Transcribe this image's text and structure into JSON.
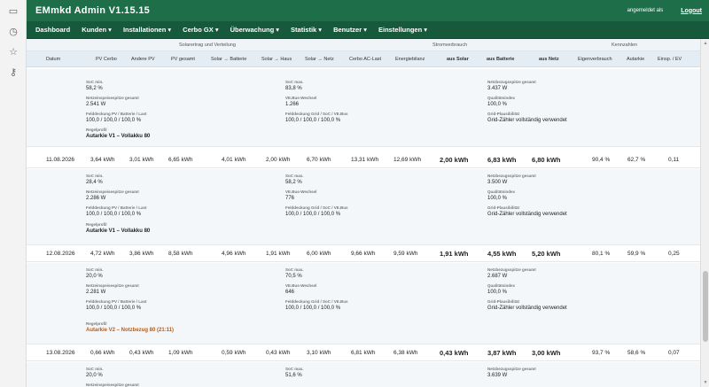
{
  "browser_rail": {
    "icons": [
      "folder-icon",
      "clock-icon",
      "star-icon",
      "key-icon"
    ]
  },
  "header": {
    "title": "EMmkd Admin V1.15.15",
    "user": "angemeldet als",
    "logout": "Logout"
  },
  "nav": {
    "items": [
      "Dashboard",
      "Kunden ▾",
      "Installationen ▾",
      "Cerbo GX ▾",
      "Überwachung ▾",
      "Statistik ▾",
      "Benutzer ▾",
      "Einstellungen ▾"
    ]
  },
  "table": {
    "groups": [
      "Solarertrag und Verteilung",
      "Stromverbrauch",
      "Kennzahlen"
    ],
    "columns": [
      "Datum",
      "PV Cerbo",
      "Andere PV",
      "PV gesamt",
      "Solar → Batterie",
      "Solar → Haus",
      "Solar → Netz",
      "Cerbo AC-Last",
      "Energiebilanz",
      "aus Solar",
      "aus Batterie",
      "aus Netz",
      "Eigenverbrauch",
      "Autarkie",
      "Einsp. / EV"
    ]
  },
  "labels": {
    "soc_min": "SoC min.",
    "soc_max": "SoC max.",
    "netzbezug_max": "Netzbezugsspitze gesamt",
    "netzeinspeisung_max": "Netzeinspeisespitze gesamt",
    "ve_bus_wechsel": "VE.Bus-Wechsel",
    "qualitaetsindex": "Qualitätsindex",
    "deckung_pv": "Felddeckung PV / Batterie / Last",
    "deckung_grid": "Felddeckung Grid / SoC / VE.Bus",
    "grid_plausi": "Grid-Plausibilität",
    "regelprofil": "Regelprofil"
  },
  "details": [
    {
      "soc_min": "58,2 %",
      "soc_max": "83,8 %",
      "netzbezug_max": "3.437 W",
      "netzeinspeisung_max": "2.541 W",
      "ve_bus_wechsel": "1.266",
      "qualitaetsindex": "100,0 %",
      "deckung_pv": "100,0 / 100,0 / 100,0 %",
      "deckung_grid": "100,0 / 100,0 / 100,0 %",
      "grid_plausi": "Grid-Zähler vollständig verwendet",
      "regelprofil": "Autarkie V1 – Vollakku 80"
    },
    {
      "soc_min": "28,4 %",
      "soc_max": "58,2 %",
      "netzbezug_max": "3.500 W",
      "netzeinspeisung_max": "2.286 W",
      "ve_bus_wechsel": "776",
      "qualitaetsindex": "100,0 %",
      "deckung_pv": "100,0 / 100,0 / 100,0 %",
      "deckung_grid": "100,0 / 100,0 / 100,0 %",
      "grid_plausi": "Grid-Zähler vollständig verwendet",
      "regelprofil": "Autarkie V1 – Vollakku 80"
    },
    {
      "soc_min": "20,0 %",
      "soc_max": "70,5 %",
      "netzbezug_max": "2.687 W",
      "netzeinspeisung_max": "2.281 W",
      "ve_bus_wechsel": "646",
      "qualitaetsindex": "100,0 %",
      "deckung_pv": "100,0 / 100,0 / 100,0 %",
      "deckung_grid": "100,0 / 100,0 / 100,0 %",
      "grid_plausi": "Grid-Zähler vollständig verwendet",
      "regelprofil": "Autarkie V2 – Notzbezug 80 (21:11)"
    },
    {
      "soc_min": "20,0 %",
      "soc_max": "51,6 %",
      "netzbezug_max": "3.639 W",
      "netzeinspeisung_max": "",
      "ve_bus_wechsel": "",
      "qualitaetsindex": "",
      "deckung_pv": "",
      "deckung_grid": "",
      "grid_plausi": "",
      "regelprofil": ""
    }
  ],
  "days": [
    {
      "date": "11.08.2026",
      "pv_cerbo": "3,64 kWh",
      "andere_pv": "3,01 kWh",
      "pv_gesamt": "6,65 kWh",
      "solar_batterie": "4,01 kWh",
      "solar_haus": "2,00 kWh",
      "solar_netz": "6,70 kWh",
      "ac_last": "13,31 kWh",
      "bilanz": "12,69 kWh",
      "aus_solar": "2,00 kWh",
      "aus_batterie": "6,83 kWh",
      "aus_netz": "6,80 kWh",
      "eigenverbrauch": "90,4 %",
      "autarkie": "62,7 %",
      "einsp": "0,11"
    },
    {
      "date": "12.08.2026",
      "pv_cerbo": "4,72 kWh",
      "andere_pv": "3,86 kWh",
      "pv_gesamt": "8,58 kWh",
      "solar_batterie": "4,96 kWh",
      "solar_haus": "1,91 kWh",
      "solar_netz": "6,00 kWh",
      "ac_last": "9,66 kWh",
      "bilanz": "9,59 kWh",
      "aus_solar": "1,91 kWh",
      "aus_batterie": "4,55 kWh",
      "aus_netz": "5,20 kWh",
      "eigenverbrauch": "80,1 %",
      "autarkie": "59,9 %",
      "einsp": "0,25"
    },
    {
      "date": "13.08.2026",
      "pv_cerbo": "0,66 kWh",
      "andere_pv": "0,43 kWh",
      "pv_gesamt": "1,09 kWh",
      "solar_batterie": "0,59 kWh",
      "solar_haus": "0,43 kWh",
      "solar_netz": "3,10 kWh",
      "ac_last": "6,81 kWh",
      "bilanz": "6,38 kWh",
      "aus_solar": "0,43 kWh",
      "aus_batterie": "3,87 kWh",
      "aus_netz": "3,00 kWh",
      "eigenverbrauch": "93,7 %",
      "autarkie": "58,6 %",
      "einsp": "0,07"
    }
  ]
}
